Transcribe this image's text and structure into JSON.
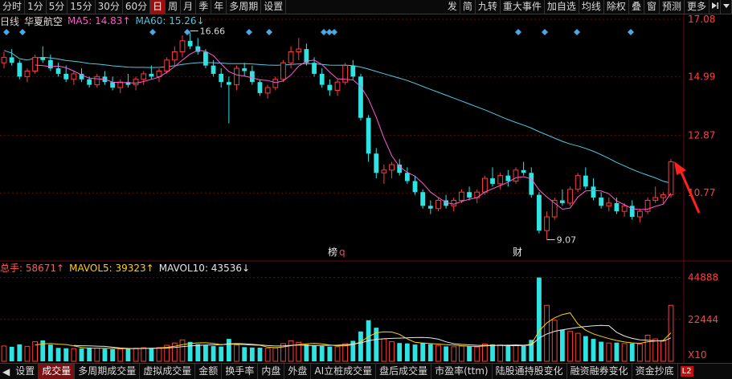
{
  "toolbar": {
    "periods": [
      "分时",
      "1分",
      "5分",
      "15分",
      "30分",
      "60分",
      "日",
      "周",
      "月",
      "季",
      "年",
      "多周期",
      "设置"
    ],
    "active_period": "日",
    "right_tools": [
      "发",
      "简",
      "九转",
      "重大事件",
      "加自选",
      "均线",
      "除权",
      "叠",
      "窗",
      "预测",
      "更多"
    ],
    "icons": [
      "step-forward-icon",
      "dropdown-icon"
    ]
  },
  "info": {
    "chart_type": "日线",
    "stock_name": "华夏航空",
    "ma5_label": "MA5: 14.83↑",
    "ma60_label": "MA60: 15.26↓"
  },
  "colors": {
    "up": "#ff3b3b",
    "down": "#2fe3e3",
    "ma5": "#ff59d6",
    "ma60": "#4fc9e6",
    "grid": "#6a0a0a",
    "axis_text": "#ff4040",
    "active_tab": "#7a1010"
  },
  "price_axis": {
    "ticks": [
      "17.08",
      "14.99",
      "12.87",
      "10.77"
    ]
  },
  "price_annotations": {
    "high": "16.66",
    "low": "9.07"
  },
  "event_markers": [
    "榜",
    "q",
    "财"
  ],
  "volume_info": {
    "total": "总手: 58671↑",
    "mavol5": "MAVOL5: 39323↑",
    "mavol10": "MAVOL10: 43536↓"
  },
  "volume_axis": {
    "ticks": [
      "44888",
      "22444",
      "X10"
    ]
  },
  "tabs": [
    "设置",
    "成交量",
    "多周期成交量",
    "虚拟成交量",
    "金额",
    "换手率",
    "内盘",
    "外盘",
    "AI立桩成交量",
    "盘后成交量",
    "市盈率(ttm)",
    "陆股通持股变化",
    "融资融券变化",
    "资金抄底"
  ],
  "active_tab": "成交量",
  "badge": "L2",
  "chart_data": {
    "type": "candlestick",
    "price_range": [
      8.5,
      17.2
    ],
    "volume_range": [
      0,
      46000
    ],
    "candles": [
      [
        15.5,
        15.9,
        15.3,
        15.7,
        8200
      ],
      [
        15.7,
        16.0,
        15.4,
        15.5,
        7800
      ],
      [
        15.5,
        15.6,
        14.9,
        15.0,
        9100
      ],
      [
        15.0,
        15.3,
        14.8,
        15.2,
        8000
      ],
      [
        15.2,
        15.8,
        15.1,
        15.7,
        10500
      ],
      [
        15.7,
        16.1,
        15.5,
        15.6,
        11200
      ],
      [
        15.6,
        15.8,
        15.2,
        15.3,
        9000
      ],
      [
        15.3,
        15.5,
        15.0,
        15.1,
        7200
      ],
      [
        15.1,
        15.4,
        14.8,
        14.9,
        7000
      ],
      [
        14.9,
        15.2,
        14.7,
        15.1,
        6800
      ],
      [
        15.1,
        15.3,
        14.8,
        14.9,
        6900
      ],
      [
        14.9,
        15.0,
        14.6,
        14.7,
        7400
      ],
      [
        14.7,
        15.1,
        14.6,
        15.0,
        7100
      ],
      [
        15.0,
        15.2,
        14.7,
        14.8,
        6700
      ],
      [
        14.8,
        15.0,
        14.5,
        14.6,
        6500
      ],
      [
        14.6,
        14.9,
        14.4,
        14.8,
        6600
      ],
      [
        14.8,
        15.1,
        14.6,
        14.7,
        6900
      ],
      [
        14.7,
        15.0,
        14.5,
        14.9,
        7000
      ],
      [
        14.9,
        15.2,
        14.7,
        15.1,
        7300
      ],
      [
        15.1,
        15.4,
        14.9,
        15.0,
        7100
      ],
      [
        15.0,
        15.3,
        14.8,
        15.2,
        7400
      ],
      [
        15.2,
        15.7,
        15.1,
        15.6,
        8600
      ],
      [
        15.6,
        16.1,
        15.4,
        15.9,
        9800
      ],
      [
        15.9,
        16.5,
        15.7,
        16.3,
        11500
      ],
      [
        16.3,
        16.6,
        16.0,
        16.1,
        10400
      ],
      [
        16.1,
        16.4,
        15.8,
        15.9,
        9200
      ],
      [
        15.9,
        16.0,
        15.3,
        15.4,
        8800
      ],
      [
        15.4,
        15.6,
        15.0,
        15.1,
        8200
      ],
      [
        15.1,
        15.3,
        14.6,
        14.8,
        7900
      ],
      [
        14.8,
        15.0,
        13.3,
        14.7,
        12000
      ],
      [
        14.7,
        15.4,
        14.5,
        15.3,
        8700
      ],
      [
        15.3,
        15.5,
        15.0,
        15.2,
        7600
      ],
      [
        15.2,
        15.4,
        14.7,
        14.8,
        7400
      ],
      [
        14.8,
        14.9,
        14.3,
        14.4,
        7300
      ],
      [
        14.4,
        14.7,
        14.2,
        14.6,
        7000
      ],
      [
        14.6,
        15.0,
        14.5,
        14.9,
        7200
      ],
      [
        14.9,
        15.6,
        14.8,
        15.5,
        9500
      ],
      [
        15.5,
        16.1,
        15.3,
        15.9,
        11000
      ],
      [
        15.9,
        16.4,
        15.6,
        16.0,
        10200
      ],
      [
        16.0,
        16.2,
        15.4,
        15.5,
        9000
      ],
      [
        15.5,
        15.7,
        15.0,
        15.1,
        8500
      ],
      [
        15.1,
        15.3,
        14.6,
        14.7,
        8200
      ],
      [
        14.7,
        14.9,
        14.3,
        14.5,
        7900
      ],
      [
        14.5,
        14.9,
        14.3,
        14.8,
        7800
      ],
      [
        14.8,
        15.5,
        14.7,
        15.4,
        9400
      ],
      [
        15.4,
        15.6,
        14.9,
        15.0,
        11000
      ],
      [
        15.0,
        15.1,
        13.4,
        13.5,
        16000
      ],
      [
        13.5,
        13.6,
        11.9,
        12.2,
        22000
      ],
      [
        12.2,
        12.4,
        11.3,
        11.5,
        18000
      ],
      [
        11.5,
        11.8,
        11.1,
        11.6,
        12000
      ],
      [
        11.6,
        11.9,
        11.3,
        11.8,
        10500
      ],
      [
        11.8,
        12.0,
        11.4,
        11.5,
        9800
      ],
      [
        11.5,
        11.7,
        11.1,
        11.2,
        9600
      ],
      [
        11.2,
        11.4,
        10.7,
        10.8,
        9000
      ],
      [
        10.8,
        10.9,
        10.2,
        10.3,
        10000
      ],
      [
        10.3,
        10.5,
        10.0,
        10.2,
        9200
      ],
      [
        10.2,
        10.6,
        10.1,
        10.5,
        8500
      ],
      [
        10.5,
        10.7,
        10.2,
        10.3,
        8000
      ],
      [
        10.3,
        10.6,
        10.1,
        10.5,
        7800
      ],
      [
        10.5,
        10.9,
        10.4,
        10.8,
        8200
      ],
      [
        10.8,
        11.0,
        10.5,
        10.6,
        8000
      ],
      [
        10.6,
        10.9,
        10.4,
        10.8,
        7700
      ],
      [
        10.8,
        11.4,
        10.7,
        11.3,
        9300
      ],
      [
        11.3,
        11.7,
        11.0,
        11.1,
        9100
      ],
      [
        11.1,
        11.5,
        10.9,
        11.4,
        8800
      ],
      [
        11.4,
        11.6,
        11.0,
        11.2,
        8600
      ],
      [
        11.2,
        11.7,
        11.1,
        11.6,
        8400
      ],
      [
        11.6,
        11.9,
        11.4,
        11.5,
        8200
      ],
      [
        11.5,
        11.7,
        10.6,
        10.7,
        11500
      ],
      [
        10.7,
        10.8,
        9.3,
        9.4,
        44888
      ],
      [
        9.4,
        10.1,
        9.07,
        9.9,
        30000
      ],
      [
        9.9,
        10.6,
        9.8,
        10.5,
        22000
      ],
      [
        10.5,
        10.9,
        10.3,
        10.4,
        17000
      ],
      [
        10.4,
        11.0,
        10.3,
        10.9,
        16000
      ],
      [
        10.9,
        11.5,
        10.8,
        11.4,
        15000
      ],
      [
        11.4,
        11.7,
        10.9,
        11.0,
        13500
      ],
      [
        11.0,
        11.3,
        10.5,
        10.6,
        12000
      ],
      [
        10.6,
        10.8,
        10.2,
        10.3,
        10500
      ],
      [
        10.3,
        10.6,
        10.1,
        10.4,
        9800
      ],
      [
        10.4,
        10.6,
        10.0,
        10.1,
        10000
      ],
      [
        10.1,
        10.4,
        9.9,
        10.3,
        9500
      ],
      [
        10.3,
        10.5,
        9.8,
        9.9,
        9600
      ],
      [
        9.9,
        10.2,
        9.7,
        10.1,
        9300
      ],
      [
        10.1,
        10.6,
        10.0,
        10.5,
        14000
      ],
      [
        10.5,
        11.0,
        10.4,
        10.6,
        12000
      ],
      [
        10.6,
        10.8,
        10.4,
        10.7,
        11000
      ],
      [
        10.7,
        12.0,
        10.6,
        11.9,
        30000
      ]
    ]
  }
}
